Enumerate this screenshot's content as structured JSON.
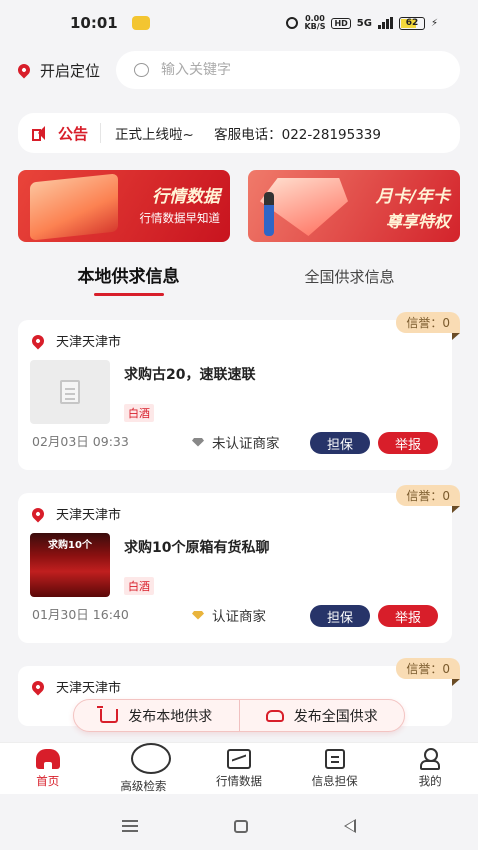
{
  "status_bar": {
    "time": "10:01",
    "speed": "0.00",
    "speed_unit": "KB/S",
    "hd": "HD",
    "network": "5G",
    "battery": "62"
  },
  "header": {
    "location_label": "开启定位",
    "search_placeholder": "输入关键字"
  },
  "notice": {
    "label": "公告",
    "message": "正式上线啦~",
    "phone_label": "客服电话：",
    "phone": "022-28195339"
  },
  "banners": [
    {
      "title": "行情数据",
      "subtitle": "行情数据早知道"
    },
    {
      "title": "月卡/年卡",
      "subtitle": "尊享特权"
    }
  ],
  "tabs": [
    {
      "label": "本地供求信息",
      "active": true
    },
    {
      "label": "全国供求信息",
      "active": false
    }
  ],
  "listings": [
    {
      "city": "天津天津市",
      "credit": "信誉：0",
      "title": "求购古20，速联速联",
      "tag": "白酒",
      "date": "02月03日 09:33",
      "merchant": "未认证商家",
      "guarantee": "担保",
      "report": "举报",
      "thumb_text": ""
    },
    {
      "city": "天津天津市",
      "credit": "信誉：0",
      "title": "求购10个原箱有货私聊",
      "tag": "白酒",
      "date": "01月30日 16:40",
      "merchant": "认证商家",
      "guarantee": "担保",
      "report": "举报",
      "thumb_text": "求购10个"
    },
    {
      "city": "天津天津市",
      "credit": "信誉：0"
    }
  ],
  "publish": {
    "local": "发布本地供求",
    "national": "发布全国供求"
  },
  "bottom_nav": [
    {
      "label": "首页",
      "icon": "home-icon",
      "active": true
    },
    {
      "label": "高级检索",
      "icon": "search-icon"
    },
    {
      "label": "行情数据",
      "icon": "chart-icon"
    },
    {
      "label": "信息担保",
      "icon": "document-icon"
    },
    {
      "label": "我的",
      "icon": "user-icon"
    }
  ],
  "colors": {
    "accent": "#d81e2a",
    "navy": "#273469",
    "credit_bg": "#f9dcb4",
    "background": "#f4f4f6"
  }
}
